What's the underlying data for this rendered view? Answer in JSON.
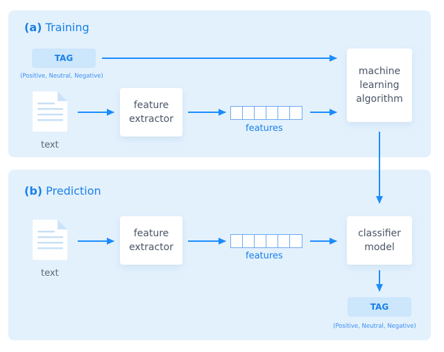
{
  "colors": {
    "panel_bg": "#e3f1fd",
    "accent": "#1a7fe8",
    "tag_bg": "#cce6fc",
    "box_text": "#4a5566"
  },
  "training": {
    "prefix": "(a)",
    "title": "Training",
    "tag_label": "TAG",
    "tag_note": "(Positive, Neutral, Negative)",
    "doc_caption": "text",
    "extractor_line1": "feature",
    "extractor_line2": "extractor",
    "features_label": "features",
    "algo_line1": "machine",
    "algo_line2": "learning",
    "algo_line3": "algorithm"
  },
  "prediction": {
    "prefix": "(b)",
    "title": "Prediction",
    "doc_caption": "text",
    "extractor_line1": "feature",
    "extractor_line2": "extractor",
    "features_label": "features",
    "model_line1": "classifier",
    "model_line2": "model",
    "tag_label": "TAG",
    "tag_note": "(Positive, Neutral, Negative)"
  }
}
